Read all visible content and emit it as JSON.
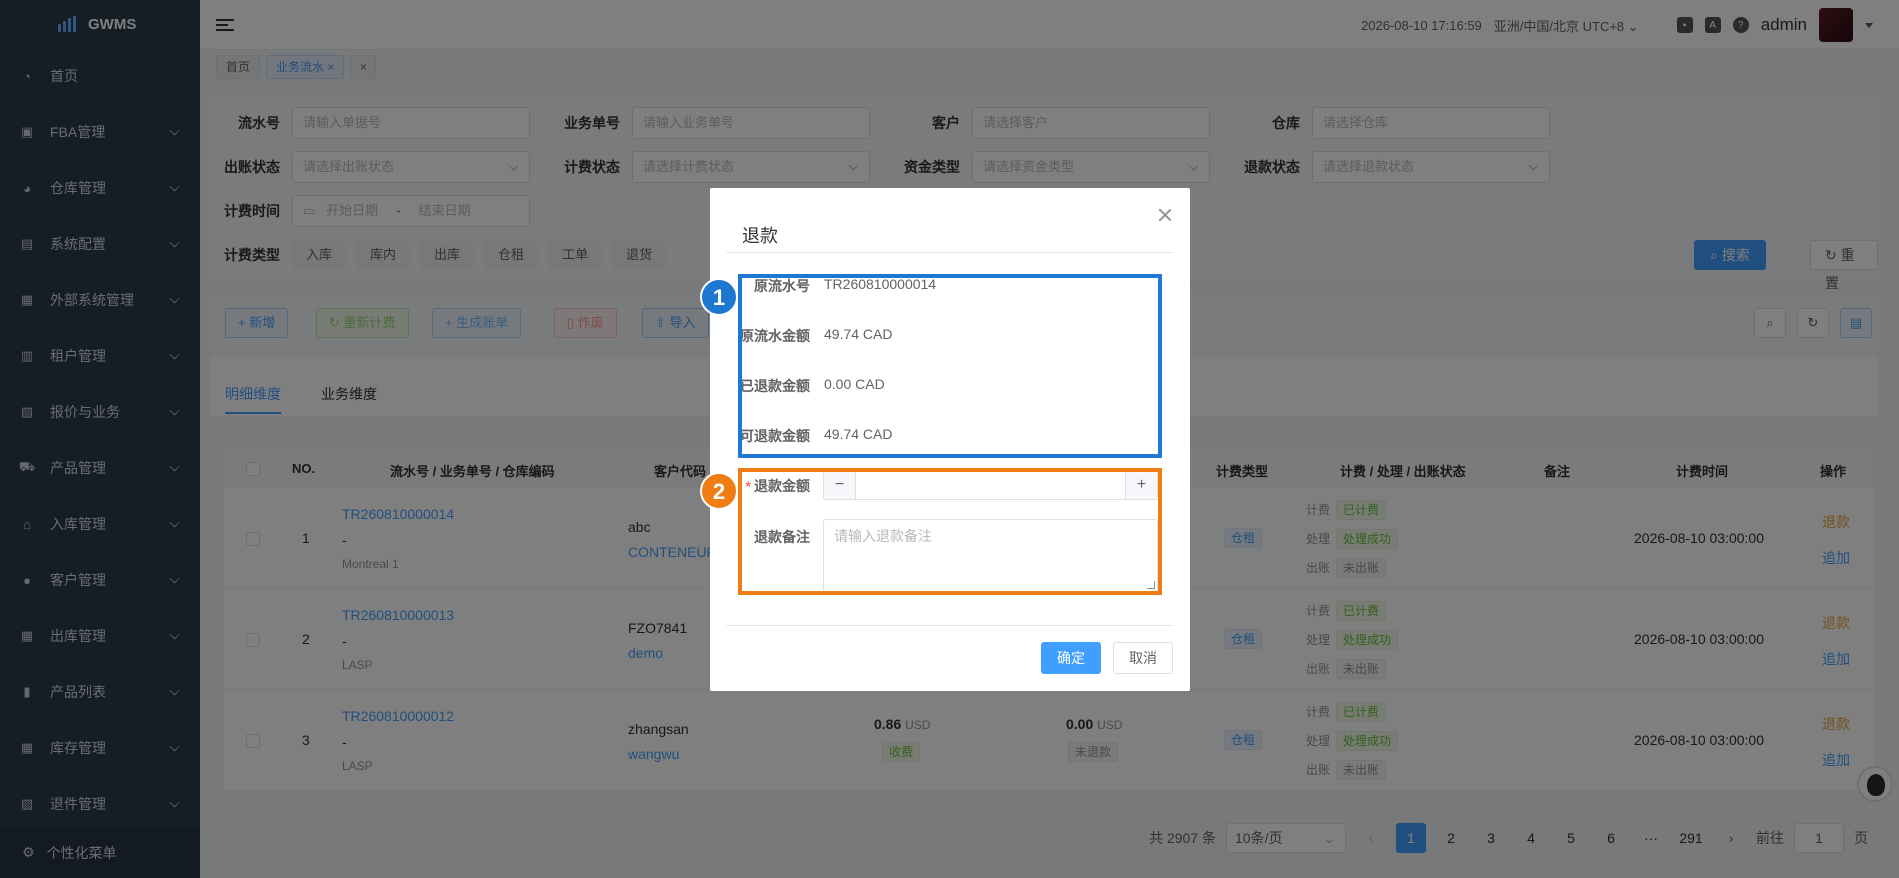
{
  "app": {
    "name": "GWMS"
  },
  "sidebar": {
    "items": [
      {
        "label": "首页",
        "icon": "dashboard-icon"
      },
      {
        "label": "FBA管理",
        "icon": "fba-icon"
      },
      {
        "label": "仓库管理",
        "icon": "warehouse-icon"
      },
      {
        "label": "系统配置",
        "icon": "config-icon"
      },
      {
        "label": "外部系统管理",
        "icon": "grid-icon"
      },
      {
        "label": "租户管理",
        "icon": "bar-chart-icon"
      },
      {
        "label": "报价与业务",
        "icon": "quote-icon"
      },
      {
        "label": "产品管理",
        "icon": "cart-icon"
      },
      {
        "label": "入库管理",
        "icon": "home-icon"
      },
      {
        "label": "客户管理",
        "icon": "user-icon"
      },
      {
        "label": "出库管理",
        "icon": "grid-icon"
      },
      {
        "label": "产品列表",
        "icon": "book-icon"
      },
      {
        "label": "库存管理",
        "icon": "table-icon"
      },
      {
        "label": "退件管理",
        "icon": "return-icon"
      }
    ],
    "footer_label": "个性化菜单"
  },
  "header": {
    "datetime": "2026-08-10 17:16:59",
    "timezone": "亚洲/中国/北京 UTC+8",
    "user": "admin"
  },
  "tags": {
    "home": "首页",
    "active": "业务流水 ×",
    "close": "×"
  },
  "filters": {
    "serial_label": "流水号",
    "serial_ph": "请输入单据号",
    "biz_label": "业务单号",
    "biz_ph": "请输入业务单号",
    "customer_label": "客户",
    "customer_ph": "请选择客户",
    "warehouse_label": "仓库",
    "warehouse_ph": "请选择仓库",
    "bill_label": "出账状态",
    "bill_ph": "请选择出账状态",
    "charge_label": "计费状态",
    "charge_ph": "请选择计费状态",
    "fund_label": "资金类型",
    "fund_ph": "请选择资金类型",
    "refund_label": "退款状态",
    "refund_ph": "请选择退款状态",
    "time_label": "计费时间",
    "start_ph": "开始日期",
    "sep": "-",
    "end_ph": "结束日期",
    "type_label": "计费类型",
    "types": [
      "入库",
      "库内",
      "出库",
      "仓租",
      "工单",
      "退货"
    ],
    "search": "搜索",
    "reset": "重置"
  },
  "toolbar": {
    "add": "新增",
    "recalc": "重新计费",
    "gen_bill": "生成账单",
    "void": "作废",
    "import": "导入"
  },
  "tabs": [
    "明细维度",
    "业务维度"
  ],
  "table": {
    "headers": {
      "no": "NO.",
      "serial": "流水号 / 业务单号 / 仓库编码",
      "customer": "客户代码",
      "charge_type": "计费类型",
      "status": "计费 / 处理 / 出账状态",
      "remark": "备注",
      "time": "计费时间",
      "op": "操作"
    },
    "status_labels": {
      "charge": "计费",
      "process": "处理",
      "bill": "出账"
    },
    "rows": [
      {
        "no": "1",
        "serial": "TR260810000014",
        "biz": "-",
        "wh": "Montreal 1",
        "cust": "abc",
        "cust2": "CONTENEUR",
        "type": "仓租",
        "s1": "已计费",
        "s2": "处理成功",
        "s3": "未出账",
        "time": "2026-08-10 03:00:00",
        "op1": "退款",
        "op2": "追加"
      },
      {
        "no": "2",
        "serial": "TR260810000013",
        "biz": "-",
        "wh": "LASP",
        "cust": "FZO7841",
        "cust2": "demo",
        "type": "仓租",
        "s1": "已计费",
        "s2": "处理成功",
        "s3": "未出账",
        "time": "2026-08-10 03:00:00",
        "op1": "退款",
        "op2": "追加"
      },
      {
        "no": "3",
        "serial": "TR260810000012",
        "biz": "-",
        "wh": "LASP",
        "cust": "zhangsan",
        "cust2": "wangwu",
        "amt": "0.86",
        "amt_unit": "USD",
        "amt_tag": "收费",
        "ref": "0.00",
        "ref_unit": "USD",
        "ref_tag": "未退款",
        "type": "仓租",
        "s1": "已计费",
        "s2": "处理成功",
        "s3": "未出账",
        "time": "2026-08-10 03:00:00",
        "op1": "退款",
        "op2": "追加"
      }
    ]
  },
  "pager": {
    "total": "共 2907 条",
    "size": "10条/页",
    "pages": [
      "1",
      "2",
      "3",
      "4",
      "5",
      "6",
      "···",
      "291"
    ],
    "goto": "前往",
    "jump": "1",
    "page_unit": "页"
  },
  "modal": {
    "title": "退款",
    "orig_serial_label": "原流水号",
    "orig_serial": "TR260810000014",
    "orig_amount_label": "原流水金额",
    "orig_amount": "49.74 CAD",
    "refunded_label": "已退款金额",
    "refunded": "0.00 CAD",
    "refundable_label": "可退款金额",
    "refundable": "49.74 CAD",
    "refund_amount_label": "退款金额",
    "remark_label": "退款备注",
    "remark_ph": "请输入退款备注",
    "ok": "确定",
    "cancel": "取消",
    "minus": "−",
    "plus": "+"
  },
  "annotations": {
    "badge1": "1",
    "badge2": "2"
  }
}
